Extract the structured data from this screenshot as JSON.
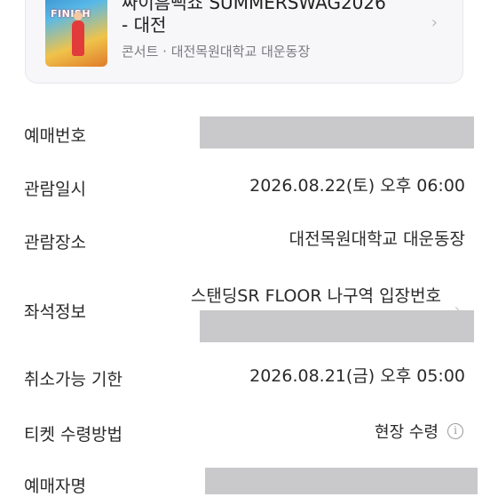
{
  "event": {
    "title": "싸이흠뻑쇼 SUMMERSWAG2026\n- 대전",
    "subtitle": "콘서트 · 대전목원대학교 대운동장",
    "poster_text": "FINISH",
    "chevron_icon": "chevron-right-icon"
  },
  "details": {
    "booking_number": {
      "label": "예매번호",
      "value": ""
    },
    "datetime": {
      "label": "관람일시",
      "value": "2026.08.22(토) 오후 06:00"
    },
    "venue": {
      "label": "관람장소",
      "value": "대전목원대학교 대운동장"
    },
    "seat": {
      "label": "좌석정보",
      "value": "스탠딩SR FLOOR 나구역 입장번호"
    },
    "cancel_deadline": {
      "label": "취소가능 기한",
      "value": "2026.08.21(금) 오후 05:00"
    },
    "pickup": {
      "label": "티켓 수령방법",
      "value": "현장 수령",
      "info_icon": "info-icon"
    },
    "booker": {
      "label": "예매자명",
      "value": ""
    }
  },
  "colors": {
    "redaction": "#c9c9cb",
    "card_background": "#f7f7f9",
    "text_primary": "#2a2a2a",
    "text_secondary": "#7a7a7f"
  }
}
